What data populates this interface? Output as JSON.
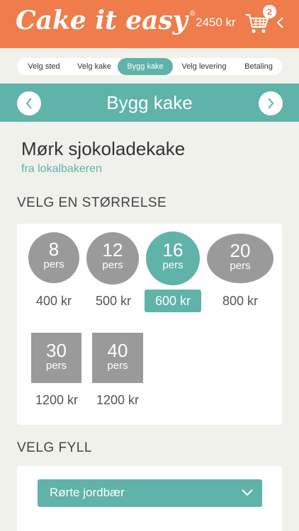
{
  "header": {
    "logo_text": "Cake it easy",
    "logo_mark": "®",
    "cart_total": "2450 kr",
    "cart_count": "2",
    "icons": [
      "cart-icon",
      "chevron-left-icon"
    ]
  },
  "steps": [
    "Velg sted",
    "Velg kake",
    "Bygg kake",
    "Velg levering",
    "Betaling"
  ],
  "active_step": "Bygg kake",
  "titlebar": {
    "title": "Bygg kake",
    "prev_icon": "chevron-left-icon",
    "next_icon": "chevron-right-icon"
  },
  "product": {
    "name": "Mørk sjokoladekake",
    "subtitle": "fra lokalbakeren"
  },
  "size_section": {
    "title": "VELG EN STØRRELSE",
    "options": [
      {
        "num": "8",
        "unit": "pers",
        "price": "400 kr",
        "selected": false,
        "shape": "round"
      },
      {
        "num": "12",
        "unit": "pers",
        "price": "500 kr",
        "selected": false,
        "shape": "round"
      },
      {
        "num": "16",
        "unit": "pers",
        "price": "600 kr",
        "selected": true,
        "shape": "round"
      },
      {
        "num": "20",
        "unit": "pers",
        "price": "800 kr",
        "selected": false,
        "shape": "round"
      },
      {
        "num": "30",
        "unit": "pers",
        "price": "1200 kr",
        "selected": false,
        "shape": "square"
      },
      {
        "num": "40",
        "unit": "pers",
        "price": "1200 kr",
        "selected": false,
        "shape": "square"
      }
    ]
  },
  "fill_section": {
    "title": "VELG FYLL",
    "selected": "Rørte jordbær",
    "icon": "chevron-down-icon"
  },
  "colors": {
    "brand_orange": "#ee7d4b",
    "accent_teal": "#5fb3a8",
    "option_grey": "#9a9a9a"
  }
}
